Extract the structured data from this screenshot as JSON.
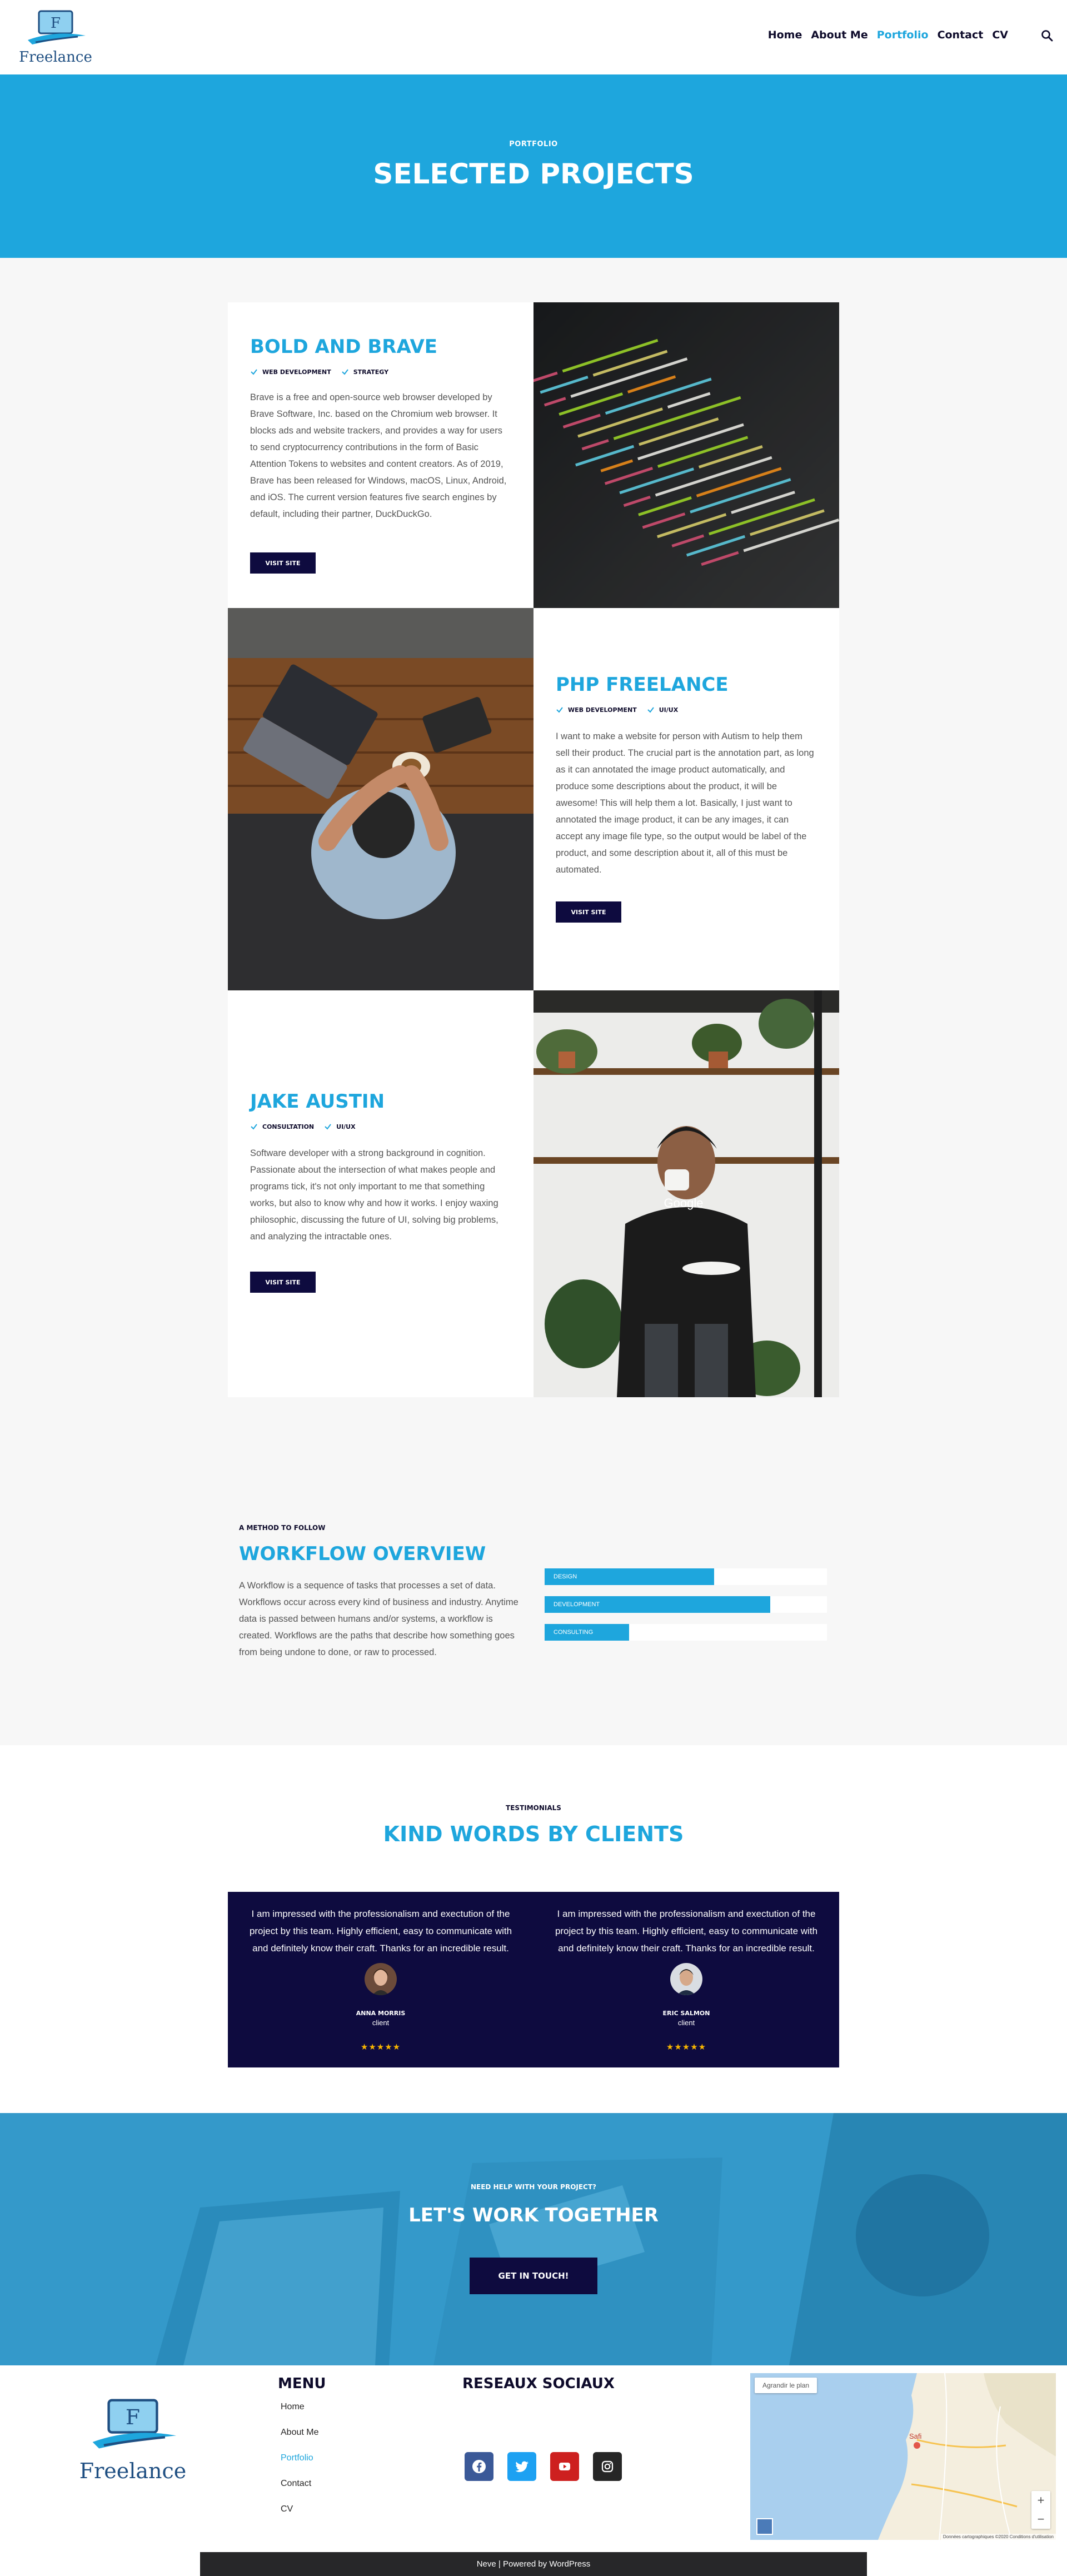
{
  "header": {
    "logo_letter": "F",
    "logo_text": "Freelance",
    "nav": [
      "Home",
      "About Me",
      "Portfolio",
      "Contact",
      "CV"
    ],
    "active_nav": "Portfolio"
  },
  "hero": {
    "kicker": "PORTFOLIO",
    "title": "SELECTED PROJECTS"
  },
  "projects": [
    {
      "title": "BOLD AND BRAVE",
      "tags": [
        "WEB DEVELOPMENT",
        "STRATEGY"
      ],
      "description": "Brave is a free and open-source web browser developed by Brave Software, Inc. based on the Chromium web browser. It blocks ads and website trackers, and provides a way for users to send cryptocurrency contributions in the form of Basic Attention Tokens to websites and content creators. As of 2019, Brave has been released for Windows, macOS, Linux, Android, and iOS. The current version features five search engines by default, including their partner, DuckDuckGo.",
      "button": "VISIT SITE"
    },
    {
      "title": "PHP FREELANCE",
      "tags": [
        "WEB DEVELOPMENT",
        "UI/UX"
      ],
      "description": "I want to make a website for person with Autism to help them sell their product. The crucial part is the annotation part, as long as it can annotated the image product automatically, and produce some descriptions about the product, it will be awesome! This will help them a lot. Basically, I just want to annotated the image product, it can be any images, it can accept any image file type, so the output would be label of the product, and some description about it, all of this must be automated.",
      "button": "VISIT SITE"
    },
    {
      "title": "JAKE AUSTIN",
      "tags": [
        "CONSULTATION",
        "UI/UX"
      ],
      "description": "Software developer with a strong background in cognition. Passionate about the intersection of what makes people and programs tick, it's not only important to me that something works, but also to know why and how it works. I enjoy waxing philosophic, discussing the future of UI, solving big problems, and analyzing the intractable ones.",
      "button": "VISIT SITE"
    }
  ],
  "workflow": {
    "kicker": "A METHOD TO FOLLOW",
    "title": "WORKFLOW OVERVIEW",
    "description": "A Workflow is a sequence of tasks that processes a set of data. Workflows occur across every kind of business and industry. Anytime data is passed between humans and/or systems, a workflow is created. Workflows are the paths that describe how something goes from being undone to done, or raw to processed.",
    "skills": [
      {
        "label": "DESIGN",
        "percent": 60
      },
      {
        "label": "DEVELOPMENT",
        "percent": 80
      },
      {
        "label": "CONSULTING",
        "percent": 30
      }
    ]
  },
  "testimonials": {
    "kicker": "TESTIMONIALS",
    "title": "KIND WORDS BY CLIENTS",
    "items": [
      {
        "quote": "I am impressed with the professionalism and exectution of the project by this team. Highly efficient, easy to communicate with and definitely know their craft. Thanks for an incredible result.",
        "name": "ANNA MORRIS",
        "role": "client",
        "stars": "★★★★★"
      },
      {
        "quote": "I am impressed with the professionalism and exectution of the project by this team. Highly efficient, easy to communicate with and definitely know their craft. Thanks for an incredible result.",
        "name": "ERIC SALMON",
        "role": "client",
        "stars": "★★★★★"
      }
    ]
  },
  "cta": {
    "kicker": "NEED HELP WITH YOUR PROJECT?",
    "title": "LET'S WORK TOGETHER",
    "button": "GET IN TOUCH!"
  },
  "footer": {
    "logo_letter": "F",
    "logo_text": "Freelance",
    "menu_title": "MENU",
    "menu": [
      "Home",
      "About Me",
      "Portfolio",
      "Contact",
      "CV"
    ],
    "active_menu": "Portfolio",
    "social_title": "RESEAUX SOCIAUX",
    "socials": [
      {
        "icon": "facebook-icon",
        "color": "#3b5998"
      },
      {
        "icon": "twitter-icon",
        "color": "#1da1f2"
      },
      {
        "icon": "youtube-icon",
        "color": "#cd201f"
      },
      {
        "icon": "instagram-icon",
        "color": "#262626"
      }
    ],
    "map_button": "Agrandir le plan",
    "map_credit": "Données cartographiques ©2020   Conditions d'utilisation",
    "map_city": "Safi",
    "credit": "Neve | Powered by WordPress"
  },
  "colors": {
    "accent": "#1ea6dd",
    "dark": "#0e0b3f",
    "background": "#f7f7f7"
  }
}
